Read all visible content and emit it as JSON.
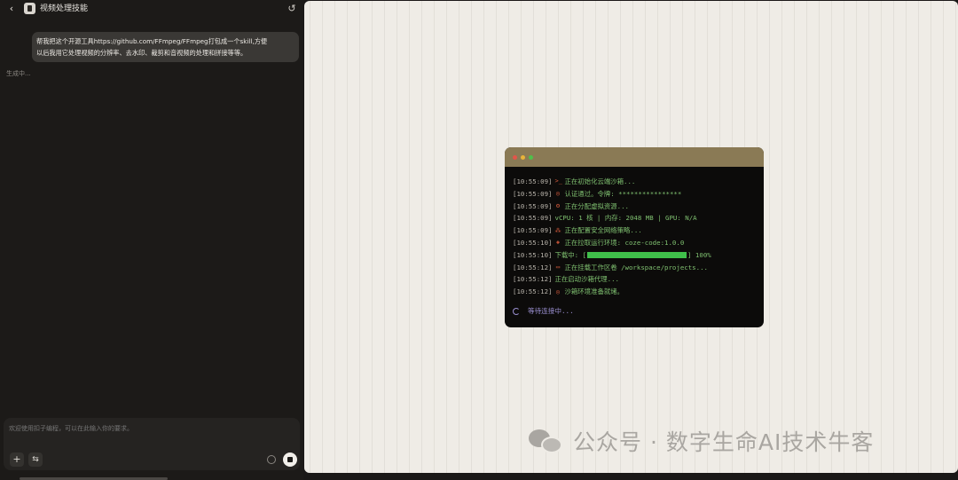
{
  "header": {
    "back_icon": "chevron-left-icon",
    "title": "视频处理技能",
    "history_icon": "history-icon"
  },
  "chat": {
    "user_message_line1": "帮我把这个开源工具https://github.com/FFmpeg/FFmpeg打包成一个skill,方便",
    "user_message_line2": "以后我用它处理视频的分辨率、去水印、裁剪和音视频的处理和拼接等等。",
    "status": "生成中..."
  },
  "input": {
    "placeholder": "欢迎使用扣子编程，可以在此输入你的要求。"
  },
  "terminal": {
    "logs": [
      {
        "ts": "[10:55:09]",
        "icon": ">_",
        "msg": "正在初始化云端沙箱..."
      },
      {
        "ts": "[10:55:09]",
        "icon": "◎",
        "msg": "认证通过。令牌: ****************"
      },
      {
        "ts": "[10:55:09]",
        "icon": "⚙",
        "msg": "正在分配虚拟资源..."
      },
      {
        "ts": "[10:55:09]",
        "icon": "",
        "msg": "vCPU: 1 核 | 内存: 2048 MB | GPU: N/A"
      },
      {
        "ts": "[10:55:09]",
        "icon": "⁂",
        "msg": "正在配置安全网络策略..."
      },
      {
        "ts": "[10:55:10]",
        "icon": "◈",
        "msg": "正在拉取运行环境: coze-code:1.0.0"
      },
      {
        "ts": "[10:55:10]",
        "icon": "",
        "msg": "下载中: ["
      },
      {
        "ts": "[10:55:12]",
        "icon": "▭",
        "msg": "正在挂载工作区卷 /workspace/projects..."
      },
      {
        "ts": "[10:55:12]",
        "icon": "",
        "msg": "正在启动沙箱代理..."
      },
      {
        "ts": "[10:55:12]",
        "icon": "◎",
        "msg": "沙箱环境准备就绪。"
      }
    ],
    "download_suffix": "] 100%",
    "download_progress": 1.0,
    "waiting": "等待连接中..."
  },
  "watermark": {
    "text": "公众号 · 数字生命AI技术牛客"
  }
}
